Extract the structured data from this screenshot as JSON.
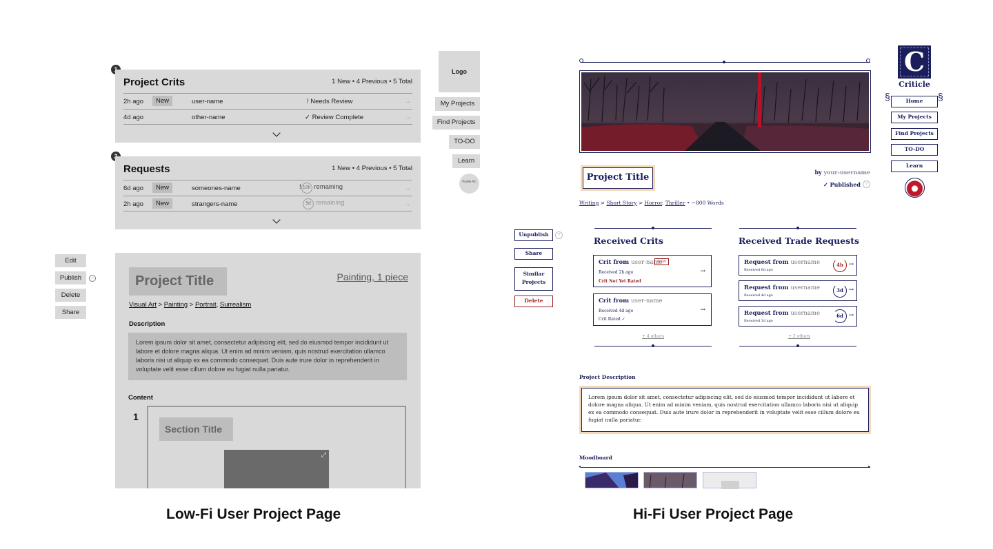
{
  "lowfi": {
    "caption": "Low-Fi User Project Page",
    "crits_panel": {
      "number": "1",
      "title": "Project Crits",
      "stats": "1 New  •  4 Previous  •  5 Total",
      "rows": [
        {
          "time": "2h ago",
          "badge": "New",
          "user": "user-name",
          "status": "!  Needs Review",
          "arrow": "→"
        },
        {
          "time": "4d ago",
          "badge": "",
          "user": "other-name",
          "status": "✓ Review Complete",
          "arrow": "→"
        }
      ]
    },
    "requests_panel": {
      "number": "2",
      "title": "Requests",
      "stats": "1 New  •  4 Previous  •  5 Total",
      "rows": [
        {
          "time": "6d ago",
          "badge": "New",
          "user": "someones-name",
          "timer": "18h",
          "prefix": "!",
          "remaining": "remaining",
          "arrow": "→"
        },
        {
          "time": "2h ago",
          "badge": "New",
          "user": "strangers-name",
          "timer": "9d",
          "prefix": "",
          "remaining": "remaining",
          "arrow": "→"
        }
      ]
    },
    "nav": {
      "logo": "Logo",
      "items": [
        "My Projects",
        "Find Projects",
        "TO-DO",
        "Learn"
      ],
      "profile": "Profile Pic"
    },
    "side_actions": [
      "Edit",
      "Publish",
      "Delete",
      "Share"
    ],
    "project": {
      "title": "Project Title",
      "medium": "Painting, 1 piece",
      "breadcrumb": [
        "Visual Art",
        "Painting",
        "Portrait",
        "Surrealism"
      ],
      "description_label": "Description",
      "description": "Lorem ipsum dolor sit amet, consectetur adipiscing elit, sed do eiusmod tempor incididunt ut labore et dolore magna aliqua. Ut enim ad minim veniam, quis nostrud exercitation ullamco laboris nisi ut aliquip ex ea commodo consequat. Duis aute irure dolor in reprehenderit in voluptate velit esse cillum dolore eu fugiat nulla pariatur.",
      "content_label": "Content",
      "section_number": "1",
      "section_title": "Section Title"
    }
  },
  "hifi": {
    "caption": "Hi-Fi User Project Page",
    "brand": "Criticle",
    "logo_letter": "C",
    "nav_items": [
      "Home",
      "My Projects",
      "Find Projects",
      "TO-DO",
      "Learn"
    ],
    "project_title": "Project Title",
    "by_label": "by",
    "username": "your-username",
    "published": "✓ Published",
    "breadcrumb": {
      "items": [
        "Writing",
        "Short Story",
        "Horror",
        "Thriller"
      ],
      "words": "~800 Words"
    },
    "actions": [
      "Unpublish",
      "Share",
      "Similar Projects",
      "Delete"
    ],
    "received_crits": {
      "title": "Received Crits",
      "cards": [
        {
          "from": "Crit from",
          "user": "user-name",
          "badge": "NEW",
          "received": "Received 2h ago",
          "status": "Crit Not Yet Rated"
        },
        {
          "from": "Crit from",
          "user": "user-name",
          "badge": "",
          "received": "Received 4d ago",
          "status": "Crit Rated ✓"
        }
      ],
      "more": "+ 4 others"
    },
    "trade_requests": {
      "title": "Received Trade Requests",
      "cards": [
        {
          "from": "Request from",
          "user": "username",
          "received": "Received 6d ago",
          "timer": "4h"
        },
        {
          "from": "Request from",
          "user": "username",
          "received": "Received 4d ago",
          "timer": "3d"
        },
        {
          "from": "Request from",
          "user": "username",
          "received": "Received 1d ago",
          "timer": "6d"
        }
      ],
      "more": "+ 2 others"
    },
    "description_label": "Project Description",
    "description": "Lorem ipsum dolor sit amet, consectetur adipiscing elit, sed do eiusmod tempor incididunt ut labore et dolore magna aliqua. Ut enim ad minim veniam, quis nostrud exercitation ullamco laboris nisi ut aliquip ex ea commodo consequat. Duis aute irure dolor in reprehenderit in voluptate velit esse cillum dolore eu fugiat nulla pariatur.",
    "moodboard_label": "Moodboard"
  },
  "colors": {
    "navy": "#1a1f5c",
    "crimson": "#9b1c1c",
    "wire_gray": "#d9d9d9"
  }
}
